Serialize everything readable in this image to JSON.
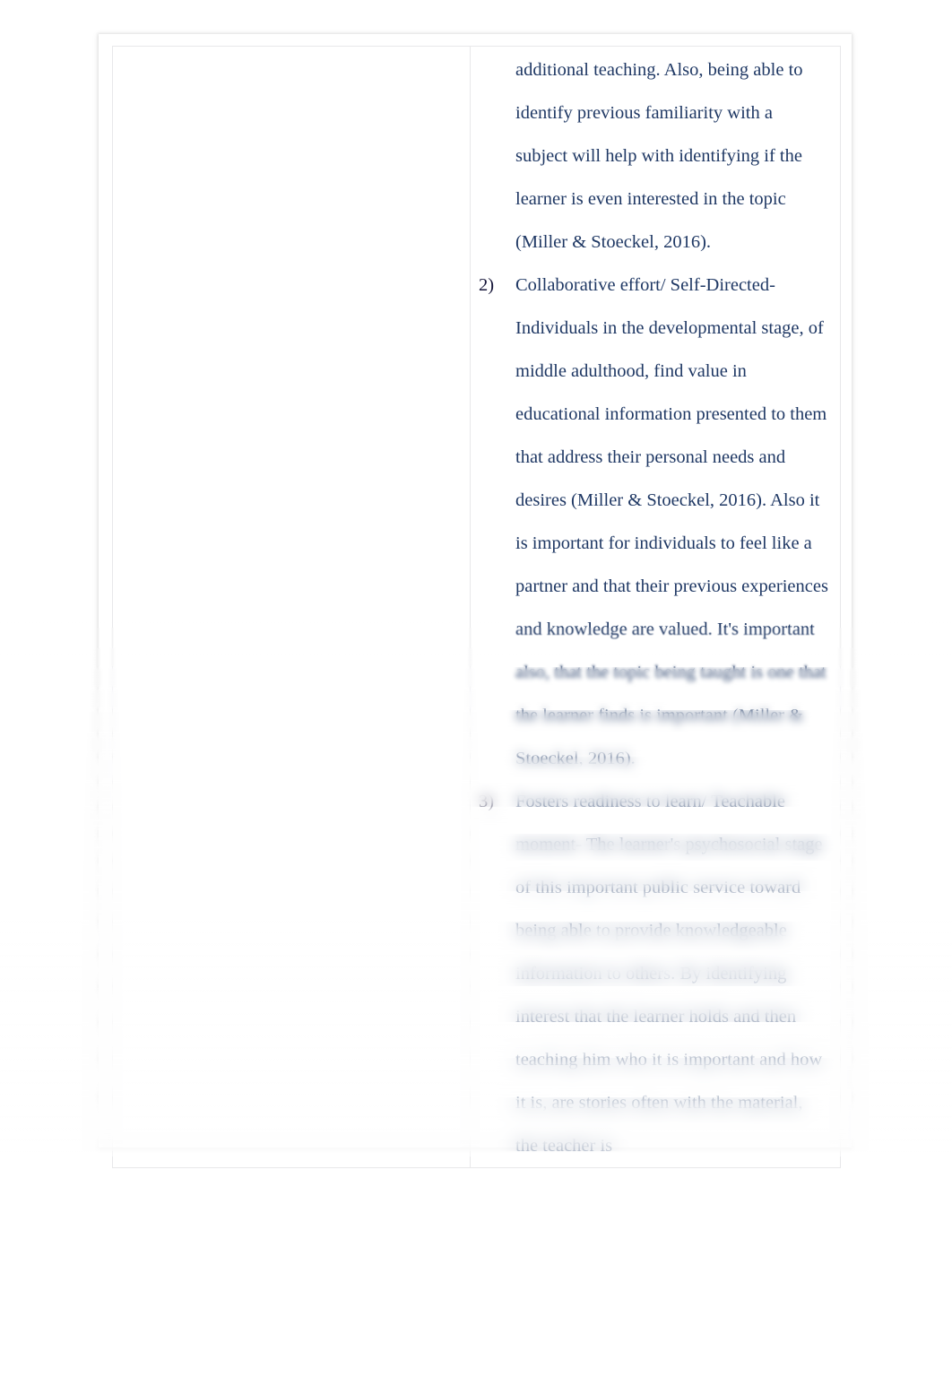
{
  "document": {
    "page_background": "#ffffff",
    "text_color": "#1f3864",
    "marker_color": "#17173a",
    "table": {
      "left_cell": {
        "content": ""
      },
      "right_cell": {
        "lead_paragraph": "additional teaching. Also, being able to identify previous familiarity with a subject will help with identifying if the learner is even interested in the topic (Miller & Stoeckel, 2016).",
        "list_items": [
          {
            "marker": "2)",
            "text": "Collaborative effort/ Self-Directed- Individuals in the developmental stage, of middle adulthood, find value in educational information presented to them that address their personal needs and desires (Miller & Stoeckel, 2016). Also it is important for individuals to feel like a partner and that their previous experiences and knowledge are valued. It's important also, that the topic being taught is one that the learner finds is important (Miller & Stoeckel, 2016)."
          },
          {
            "marker": "3)",
            "text": "Fosters readiness to learn/ Teachable moment- The learner's psychosocial stage of this important public service toward being able to provide knowledgeable information to others. By identifying interest that the learner holds and then teaching him who it is important and how it is, are stories often with the material, the teacher is"
          }
        ]
      }
    }
  }
}
